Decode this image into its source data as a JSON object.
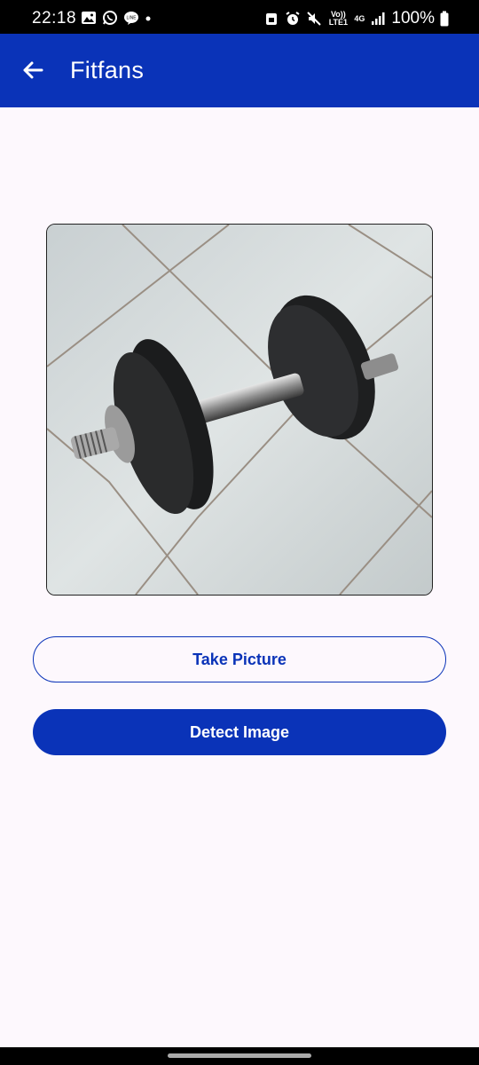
{
  "status_bar": {
    "time": "22:18",
    "battery_percent": "100%",
    "volte_label": "Vo)) LTE1",
    "network_label": "4G",
    "left_icons": [
      "gallery-icon",
      "whatsapp-icon",
      "line-icon",
      "dot-icon"
    ],
    "right_icons": [
      "screenshot-lock-icon",
      "alarm-icon",
      "mute-icon",
      "volte-icon",
      "network-4g-icon",
      "signal-icon",
      "battery-icon"
    ]
  },
  "app_bar": {
    "title": "Fitfans",
    "back_icon": "arrow-left-icon",
    "color": "#0a33b8"
  },
  "photo": {
    "subject": "dumbbell-on-tile-floor"
  },
  "buttons": {
    "take_picture": "Take Picture",
    "detect_image": "Detect Image"
  },
  "colors": {
    "primary": "#0a33b8",
    "background": "#fdf8fd"
  }
}
